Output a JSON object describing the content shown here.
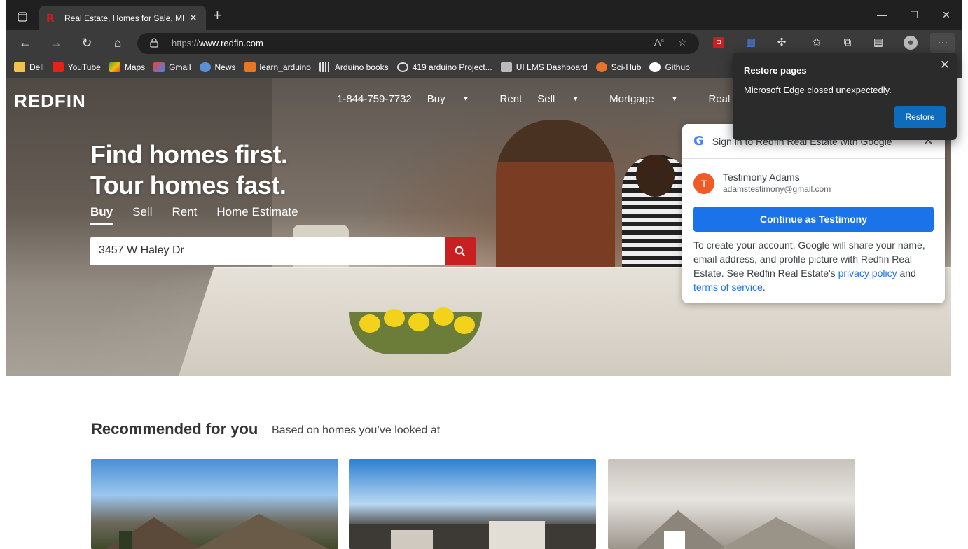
{
  "browser": {
    "tab_title": "Real Estate, Homes for Sale, MLS",
    "url_scheme": "https://",
    "url_host": "www.redfin.com",
    "bookmarks": [
      "Dell",
      "YouTube",
      "Maps",
      "Gmail",
      "News",
      "learn_arduino",
      "Arduino books",
      "419 arduino Project...",
      "UI LMS Dashboard",
      "Sci-Hub",
      "Github"
    ]
  },
  "restore_popup": {
    "title": "Restore pages",
    "message": "Microsoft Edge closed unexpectedly.",
    "button": "Restore"
  },
  "site": {
    "logo": "REDFIN",
    "nav": {
      "phone": "1-844-759-7732",
      "buy": "Buy",
      "rent": "Rent",
      "sell": "Sell",
      "mortgage": "Mortgage",
      "agents": "Real Estate Agents"
    },
    "headline_1": "Find homes first.",
    "headline_2": "Tour homes fast.",
    "search_tabs": [
      "Buy",
      "Sell",
      "Rent",
      "Home Estimate"
    ],
    "search_value": "3457 W Haley Dr",
    "recommended_title": "Recommended for you",
    "recommended_sub": "Based on homes you’ve looked at"
  },
  "google_signin": {
    "header": "Sign in to Redfin Real Estate with Google",
    "name": "Testimony Adams",
    "email": "adamstestimony@gmail.com",
    "avatar_letter": "T",
    "continue_label": "Continue as Testimony",
    "text_1": "To create your account, Google will share your name, email address, and profile picture with Redfin Real Estate. See Redfin Real Estate's ",
    "privacy_link": "privacy policy",
    "text_and": " and ",
    "terms_link": "terms of service",
    "text_end": "."
  },
  "colors": {
    "redfin_red": "#c82021",
    "google_blue": "#1a73e8",
    "edge_blue": "#0f6cbd"
  }
}
